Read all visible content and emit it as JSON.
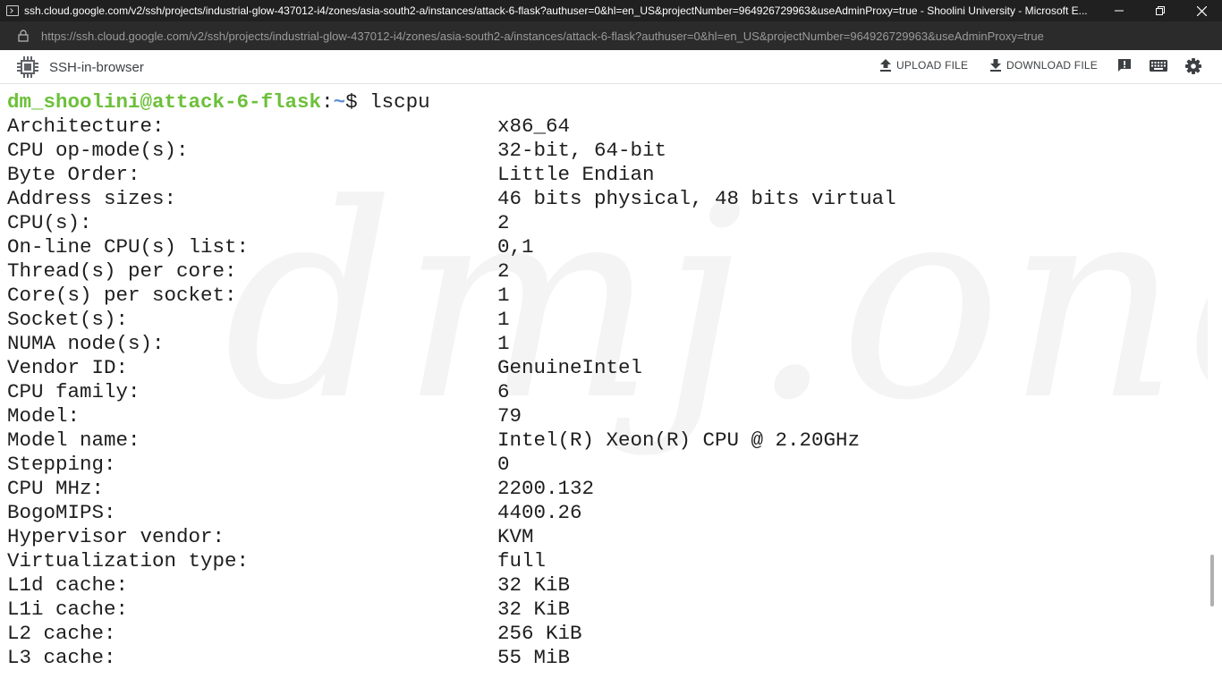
{
  "window": {
    "title": "ssh.cloud.google.com/v2/ssh/projects/industrial-glow-437012-i4/zones/asia-south2-a/instances/attack-6-flask?authuser=0&hl=en_US&projectNumber=964926729963&useAdminProxy=true - Shoolini University - Microsoft E...",
    "minimize_icon": "minimize-icon",
    "maximize_icon": "restore-icon",
    "close_icon": "close-icon"
  },
  "address_bar": {
    "url": "https://ssh.cloud.google.com/v2/ssh/projects/industrial-glow-437012-i4/zones/asia-south2-a/instances/attack-6-flask?authuser=0&hl=en_US&projectNumber=964926729963&useAdminProxy=true"
  },
  "toolbar": {
    "app_name": "SSH-in-browser",
    "upload_label": "UPLOAD FILE",
    "download_label": "DOWNLOAD FILE",
    "icons": [
      "chip-icon",
      "upload-icon",
      "download-icon",
      "feedback-icon",
      "keyboard-icon",
      "settings-icon"
    ]
  },
  "terminal": {
    "prompt_user": "dm_shoolini@attack-6-flask",
    "prompt_sep": ":",
    "prompt_path": "~",
    "prompt_symbol": "$ ",
    "command": "lscpu",
    "watermark": "dmj.one",
    "rows": [
      {
        "label": "Architecture:",
        "value": "x86_64"
      },
      {
        "label": "CPU op-mode(s):",
        "value": "32-bit, 64-bit"
      },
      {
        "label": "Byte Order:",
        "value": "Little Endian"
      },
      {
        "label": "Address sizes:",
        "value": "46 bits physical, 48 bits virtual"
      },
      {
        "label": "CPU(s):",
        "value": "2"
      },
      {
        "label": "On-line CPU(s) list:",
        "value": "0,1"
      },
      {
        "label": "Thread(s) per core:",
        "value": "2"
      },
      {
        "label": "Core(s) per socket:",
        "value": "1"
      },
      {
        "label": "Socket(s):",
        "value": "1"
      },
      {
        "label": "NUMA node(s):",
        "value": "1"
      },
      {
        "label": "Vendor ID:",
        "value": "GenuineIntel"
      },
      {
        "label": "CPU family:",
        "value": "6"
      },
      {
        "label": "Model:",
        "value": "79"
      },
      {
        "label": "Model name:",
        "value": "Intel(R) Xeon(R) CPU @ 2.20GHz"
      },
      {
        "label": "Stepping:",
        "value": "0"
      },
      {
        "label": "CPU MHz:",
        "value": "2200.132"
      },
      {
        "label": "BogoMIPS:",
        "value": "4400.26"
      },
      {
        "label": "Hypervisor vendor:",
        "value": "KVM"
      },
      {
        "label": "Virtualization type:",
        "value": "full"
      },
      {
        "label": "L1d cache:",
        "value": "32 KiB"
      },
      {
        "label": "L1i cache:",
        "value": "32 KiB"
      },
      {
        "label": "L2 cache:",
        "value": "256 KiB"
      },
      {
        "label": "L3 cache:",
        "value": "55 MiB"
      }
    ]
  },
  "colors": {
    "prompt_user": "#6cc03a",
    "prompt_path": "#5c8fd6",
    "title_bar": "#202020",
    "address_bar": "#2b2b2b"
  }
}
